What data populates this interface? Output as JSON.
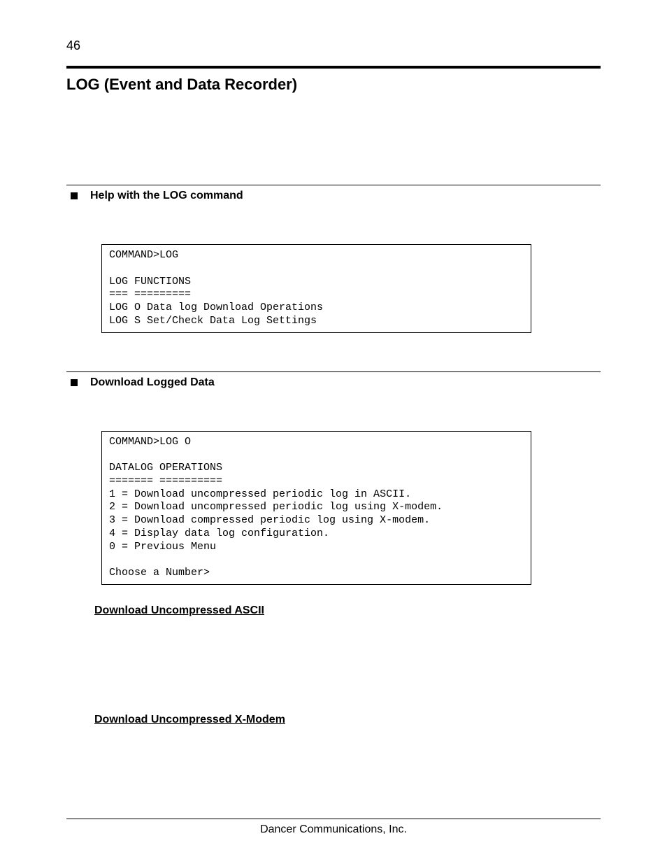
{
  "page_number": "46",
  "title": "LOG (Event and Data Recorder)",
  "sections": [
    {
      "heading": "Help with the LOG command",
      "code": "COMMAND>LOG\n\nLOG FUNCTIONS\n=== =========\nLOG O Data log Download Operations\nLOG S Set/Check Data Log Settings"
    },
    {
      "heading": "Download Logged Data",
      "code": "COMMAND>LOG O\n\nDATALOG OPERATIONS\n======= ==========\n1 = Download uncompressed periodic log in ASCII.\n2 = Download uncompressed periodic log using X-modem.\n3 = Download compressed periodic log using X-modem.\n4 = Display data log configuration.\n0 = Previous Menu\n\nChoose a Number>"
    }
  ],
  "link_headings": [
    "Download Uncompressed ASCII",
    "Download Uncompressed X-Modem"
  ],
  "footer": "Dancer Communications, Inc."
}
